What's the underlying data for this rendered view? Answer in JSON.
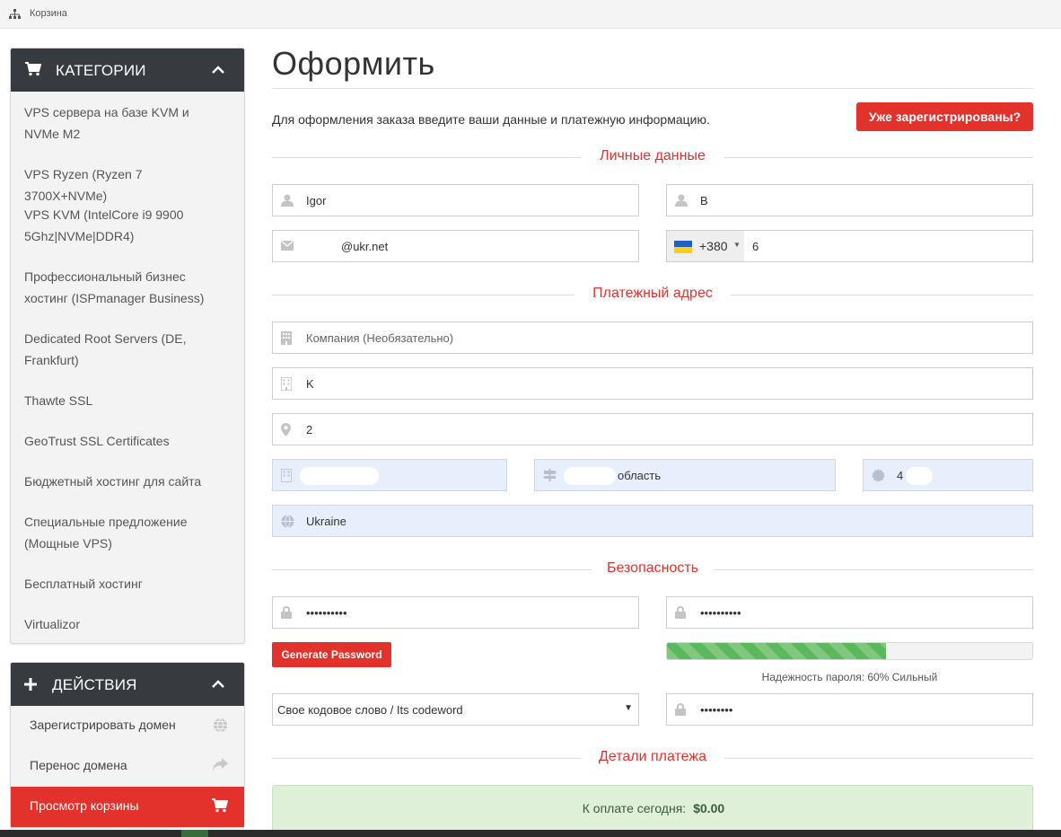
{
  "breadcrumb": {
    "icon": "sitemap-icon",
    "label": "Корзина"
  },
  "sidebar": {
    "categories": {
      "title": "КАТЕГОРИИ",
      "icon": "cart-icon",
      "items": [
        "VPS сервера на базе KVM и NVMe M2",
        "VPS Ryzen (Ryzen 7 3700X+NVMe)",
        "VPS KVM (IntelCore i9 9900 5Ghz|NVMe|DDR4)",
        "Профессиональный бизнес хостинг (ISPmanager Business)",
        "Dedicated Root Servers (DE, Frankfurt)",
        "Thawte SSL",
        "GeoTrust SSL Certificates",
        "Бюджетный хостинг для сайта",
        "Специальные предложение (Мощные VPS)",
        "Бесплатный хостинг",
        "Virtualizor"
      ]
    },
    "actions": {
      "title": "ДЕЙСТВИЯ",
      "icon": "plus-icon",
      "items": [
        {
          "label": "Зарегистрировать домен",
          "icon": "globe-icon"
        },
        {
          "label": "Перенос домена",
          "icon": "share-arrow-icon"
        },
        {
          "label": "Просмотр корзины",
          "icon": "cart-icon"
        }
      ]
    }
  },
  "main": {
    "title": "Оформить",
    "intro": "Для оформления заказа введите ваши данные и платежную информацию.",
    "registered_button": "Уже зарегистрированы?",
    "sections": {
      "personal": "Личные данные",
      "billing": "Платежный адрес",
      "security": "Безопасность",
      "payment": "Детали платежа"
    },
    "personal": {
      "first_name": "Igor",
      "last_name": "B",
      "email": "@ukr.net",
      "phone_code": "+380",
      "phone": "6"
    },
    "billing": {
      "company_placeholder": "Компания (Необязательно)",
      "address1": "K",
      "address2": "2",
      "city": "",
      "state": "область",
      "postcode": "4",
      "country": "Ukraine"
    },
    "security": {
      "password": "••••••••••",
      "password_confirm": "••••••••••",
      "generate_button": "Generate Password",
      "strength_percent": 60,
      "strength_text": "Надежность пароля: 60% Сильный",
      "codeword_select": "Свое кодовое слово / Its codeword",
      "codeword": "••••••••"
    },
    "payment": {
      "label": "К оплате сегодня:",
      "amount": "$0.00"
    }
  },
  "colors": {
    "accent": "#e2322b",
    "panel_head": "#373b40",
    "strength": "#5cb85c",
    "total_bg": "#dff0d8"
  }
}
